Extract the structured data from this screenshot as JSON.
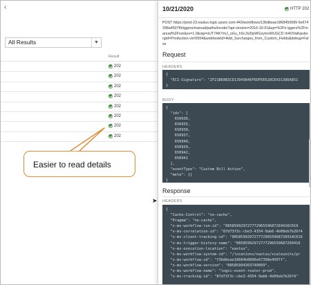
{
  "left": {
    "filter_value": "All Results",
    "column_result": "Result",
    "rows": [
      {
        "status": "202"
      },
      {
        "status": "202"
      },
      {
        "status": "202"
      },
      {
        "status": "202"
      },
      {
        "status": "202"
      },
      {
        "status": "202"
      },
      {
        "status": "202"
      },
      {
        "status": "202"
      }
    ]
  },
  "callout": {
    "text": "Easier to read details"
  },
  "details": {
    "date": "10/21/2020",
    "http_status": "HTTP 202",
    "url": "POST https://prod-23.eastus.logic.azure.com:443/workflows/136dbeae1868450689 6e674398a4507f/triggers/manual/paths/invoke?api-version=2016-10-01&sp=%2Ftr iggers%2Fmanual%2Frun&sv=1.0&sig=oUT7AKYmJ_oGu_hScJtzDpWGzymxWUGCD rh4OVaKqo&orgId=Production.vm!0004&webhookId=Add_Surcharges_from_Custom_Fields&debug=False",
    "request_title": "Request",
    "headers_label": "HEADERS",
    "request_headers_code": "{\n  \"ECI-Signature\": \"2F21BEAB3CD13949846F6DFEE628CEA31386A851\n}",
    "body_label": "BODY",
    "request_body_code": "{\n  \"ids\": [\n    650936,\n    650935,\n    650938,\n    650937,\n    650940,\n    650939,\n    650942,\n    650941\n  ],\n  \"eventType\": \"Custom Bill Action\",\n  \"meta\": {}\n}",
    "response_title": "Response",
    "response_headers_label": "HEADERS",
    "response_headers_code": "{\n  \"Cache-Control\": \"no-cache\",\n  \"Pragma\": \"no-cache\",\n  \"x-ms-workflow-run-id\": \"08585992972777296559687269416C019\n  \"x-ms-correlation-id\": \"87d73f3c-cbe3-4354-9ab6-4b09eb7b26f4\n  \"x-ms-client-tracking-id\": \"0858599297277729655968726914C019\n  \"x-ms-trigger-history-name\": \"08585992972777296559687269416\n  \"x-ms-execution-location\": \"eastus\",\n  \"x-ms-workflow-system-id\": \"/locations/eastus/scaleunits/pr\n  \"x-ms-workflow-id\": \"f36dbeae18684b0896e67398e4507f\",\n  \"x-ms-workflow-version\": \"08585994363740899\",\n  \"x-ms-workflow-name\": \"logic-event-router-prod\",\n  \"x-ms-tracking-id\": \"87d73f3c-cbe3-4354-9ab6-4b09eb7b26f4\""
  }
}
